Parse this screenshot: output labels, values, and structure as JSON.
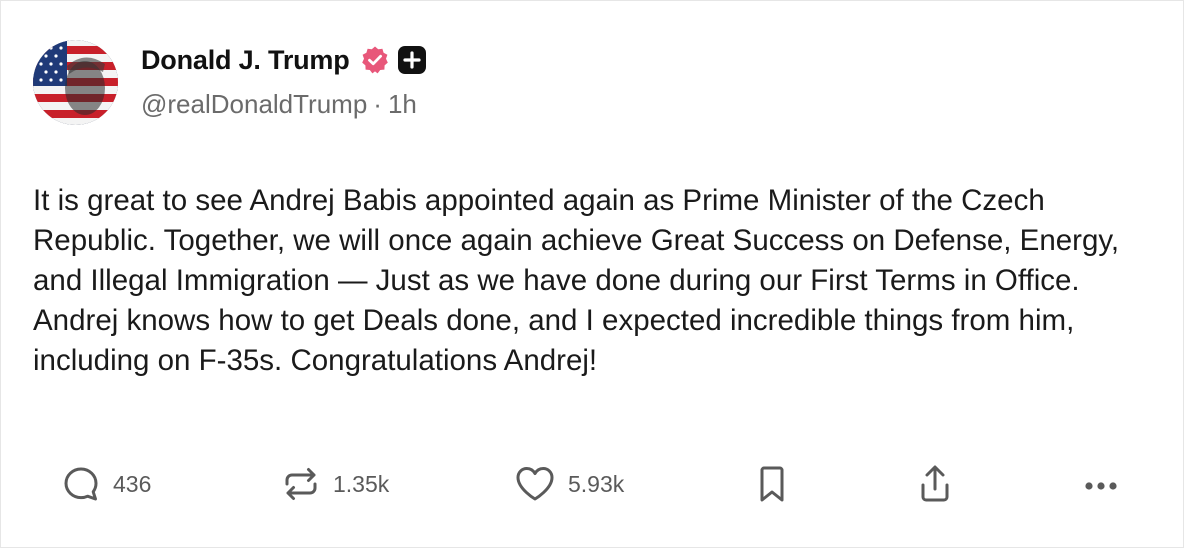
{
  "post": {
    "author_name": "Donald J. Trump",
    "handle": "@realDonaldTrump",
    "separator": "·",
    "time_ago": "1h",
    "body": "It is great to see Andrej Babis appointed again as Prime Minister of the Czech Republic. Together, we will once again achieve Great Success on Defense, Energy, and Illegal Immigration — Just as we have done during our First Terms in Office. Andrej knows how to get Deals done, and I expected incredible things from him, including on F-35s. Congratulations Andrej!"
  },
  "actions": {
    "reply_count": "436",
    "repost_count": "1.35k",
    "like_count": "5.93k"
  },
  "icons": {
    "verified_badge": "verified-badge-icon",
    "follow": "plus-icon",
    "reply": "chat-bubble-icon",
    "repost": "repost-arrows-icon",
    "like": "heart-icon",
    "bookmark": "bookmark-icon",
    "share": "share-upload-icon",
    "more": "more-dots-icon"
  },
  "colors": {
    "verified": "#e8577a",
    "text": "#1a1a1a",
    "muted": "#6b6b6b",
    "icon": "#5a5a5a"
  }
}
